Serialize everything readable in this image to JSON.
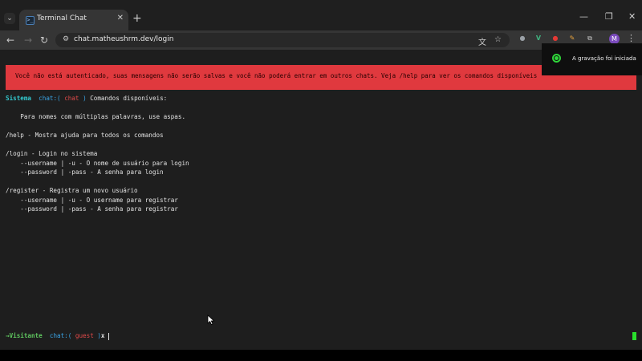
{
  "browser": {
    "tab_search_glyph": "⌄",
    "tab": {
      "title": "Terminal Chat",
      "favicon_glyph": ">_",
      "close_glyph": "✕"
    },
    "new_tab_glyph": "+",
    "window_controls": {
      "minimize": "—",
      "maximize": "❐",
      "close": "✕"
    },
    "nav": {
      "back": "←",
      "forward": "→",
      "reload": "↻"
    },
    "address": {
      "url": "chat.matheushrm.dev/login",
      "site_info_glyph": "⚙"
    },
    "omnibox_icons": {
      "translate": "文",
      "bookmark": "☆"
    },
    "extensions": [
      {
        "name": "extension-1-icon",
        "glyph": "●",
        "color": "#9aa0a6"
      },
      {
        "name": "vue-devtools-icon",
        "glyph": "V",
        "color": "#3fb27f"
      },
      {
        "name": "extension-red-icon",
        "glyph": "●",
        "color": "#e53935"
      },
      {
        "name": "pen-extension-icon",
        "glyph": "✎",
        "color": "#e8a33d"
      },
      {
        "name": "puzzle-icon",
        "glyph": "⧉",
        "color": "#c8c8c8"
      }
    ],
    "profile_initial": "M",
    "menu_glyph": "⋮"
  },
  "toast": {
    "text": "A gravação foi iniciada"
  },
  "terminal": {
    "auth_warning": "Você não está autenticado, suas mensagens não serão salvas e você não poderá entrar em outros chats. Veja /help para ver os comandos disponíveis",
    "system_line": {
      "sender": "Sistema",
      "chat_prefix": "chat:(",
      "chat_name": "chat",
      "chat_suffix": ")",
      "message": "Comandos disponíveis:"
    },
    "help_lines": [
      "    Para nomes com múltiplas palavras, use aspas.",
      "",
      "/help - Mostra ajuda para todos os comandos",
      "",
      "/login - Login no sistema",
      "    --username | -u - O nome de usuário para login",
      "    --password | -pass - A senha para login",
      "",
      "/register - Registra um novo usuário",
      "    --username | -u - O username para registrar",
      "    --password | -pass - A senha para registrar"
    ],
    "prompt": {
      "arrow": "→",
      "user": "Visitante",
      "chat_prefix": "chat:(",
      "chat_name": "guest",
      "chat_suffix": ")",
      "symbol": "x",
      "input_value": ""
    }
  }
}
